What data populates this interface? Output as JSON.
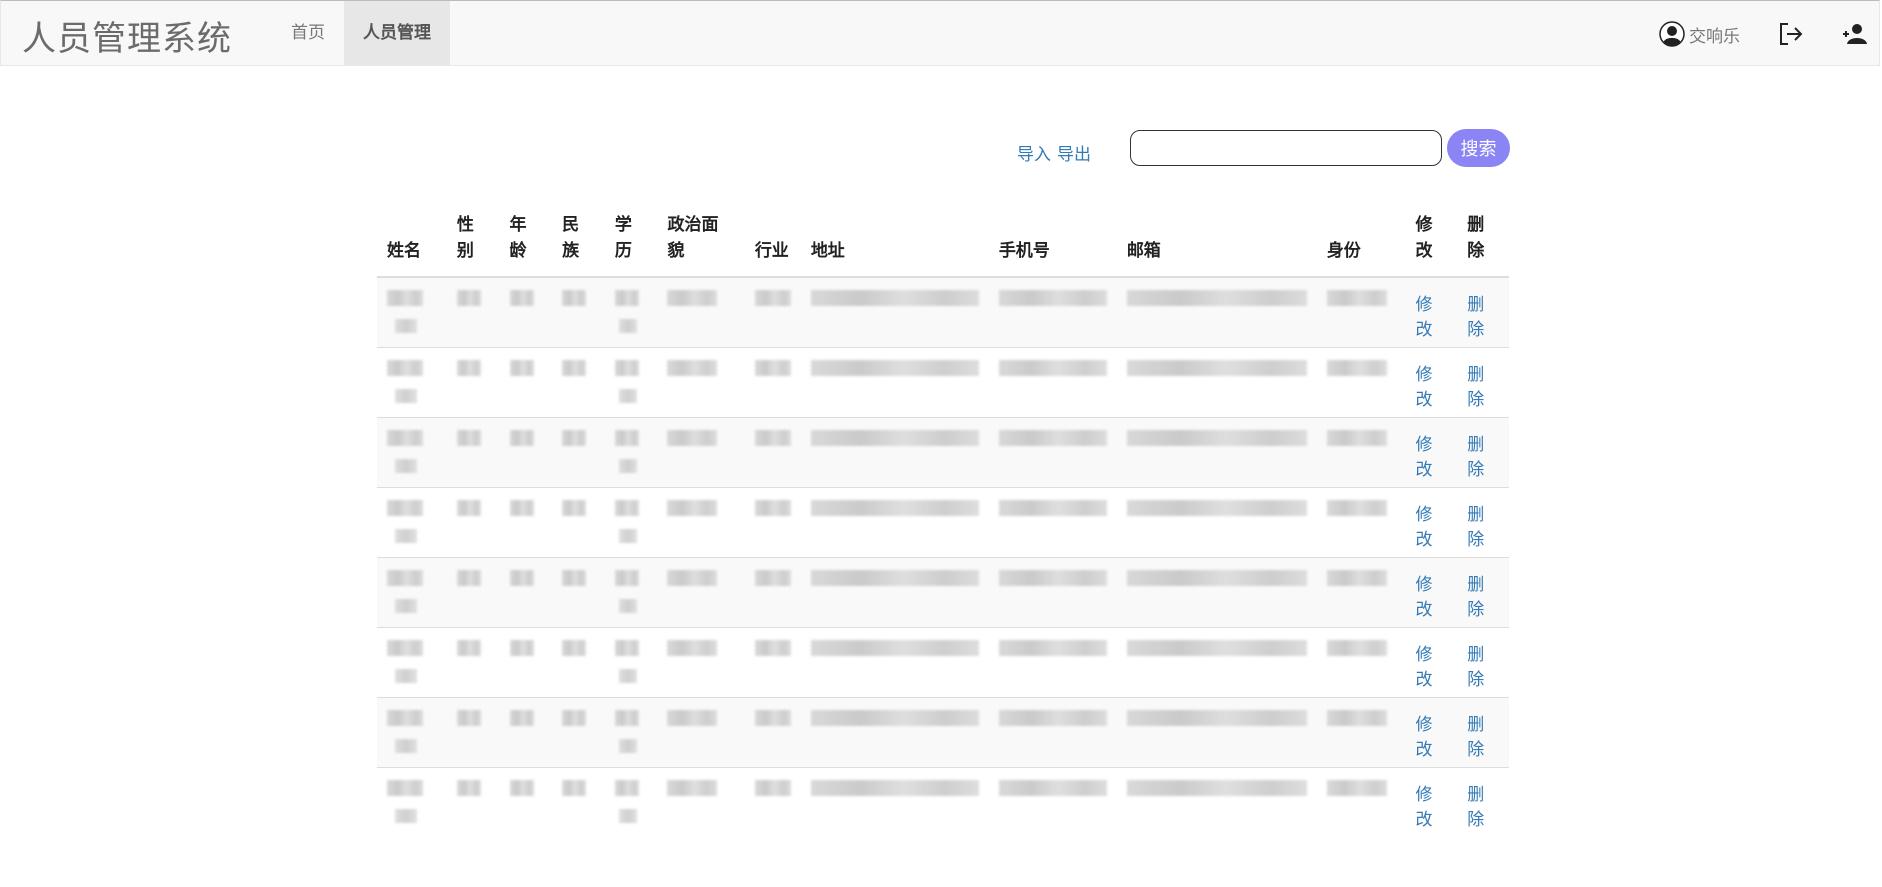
{
  "navbar": {
    "brand": "人员管理系统",
    "nav_home": "首页",
    "nav_people": "人员管理",
    "user_name": "交响乐"
  },
  "toolbar": {
    "import_label": "导入",
    "export_label": "导出",
    "search_placeholder": "",
    "search_button": "搜索"
  },
  "table": {
    "headers": [
      "姓名",
      "性别",
      "年龄",
      "民族",
      "学历",
      "政治面貌",
      "行业",
      "地址",
      "手机号",
      "邮箱",
      "身份",
      "修改",
      "删除"
    ],
    "edit_label": "修改",
    "delete_label": "删除",
    "row_count": 8
  },
  "colors": {
    "search_button": "#8b84f5",
    "link": "#337ab7",
    "navbar_bg": "#f8f8f8"
  }
}
